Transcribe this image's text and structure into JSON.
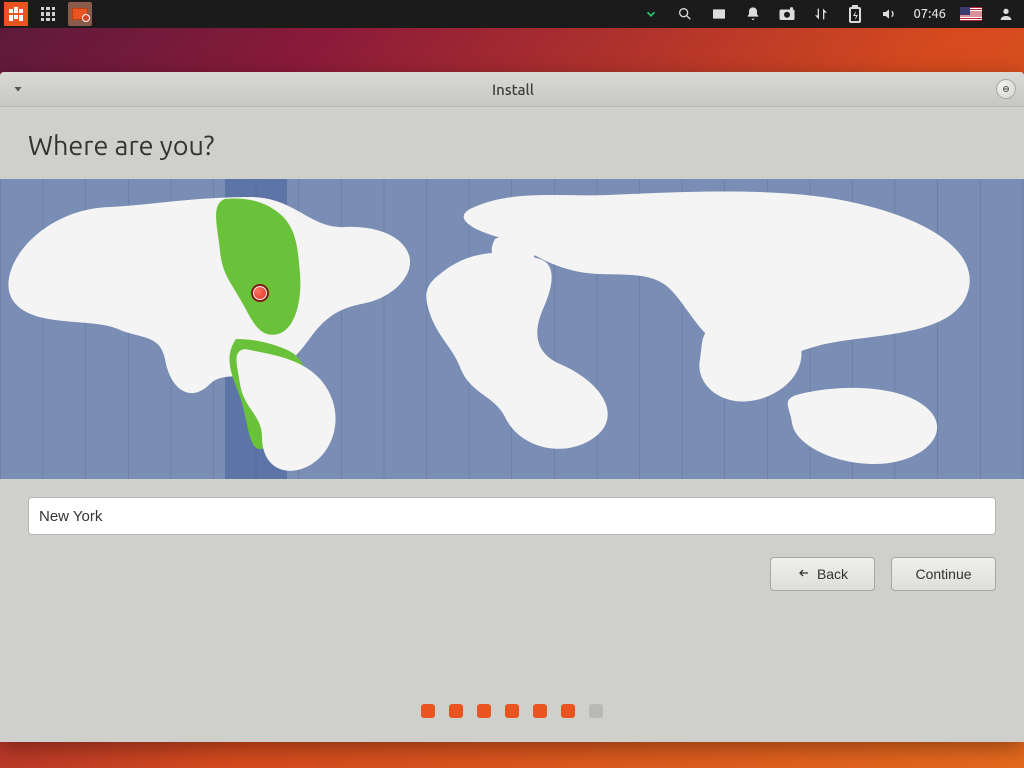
{
  "panel": {
    "clock": "07:46"
  },
  "window": {
    "title": "Install"
  },
  "page": {
    "heading": "Where are you?",
    "location_value": "New York",
    "back_label": "Back",
    "continue_label": "Continue"
  },
  "progress": {
    "total": 7,
    "done": 6
  }
}
